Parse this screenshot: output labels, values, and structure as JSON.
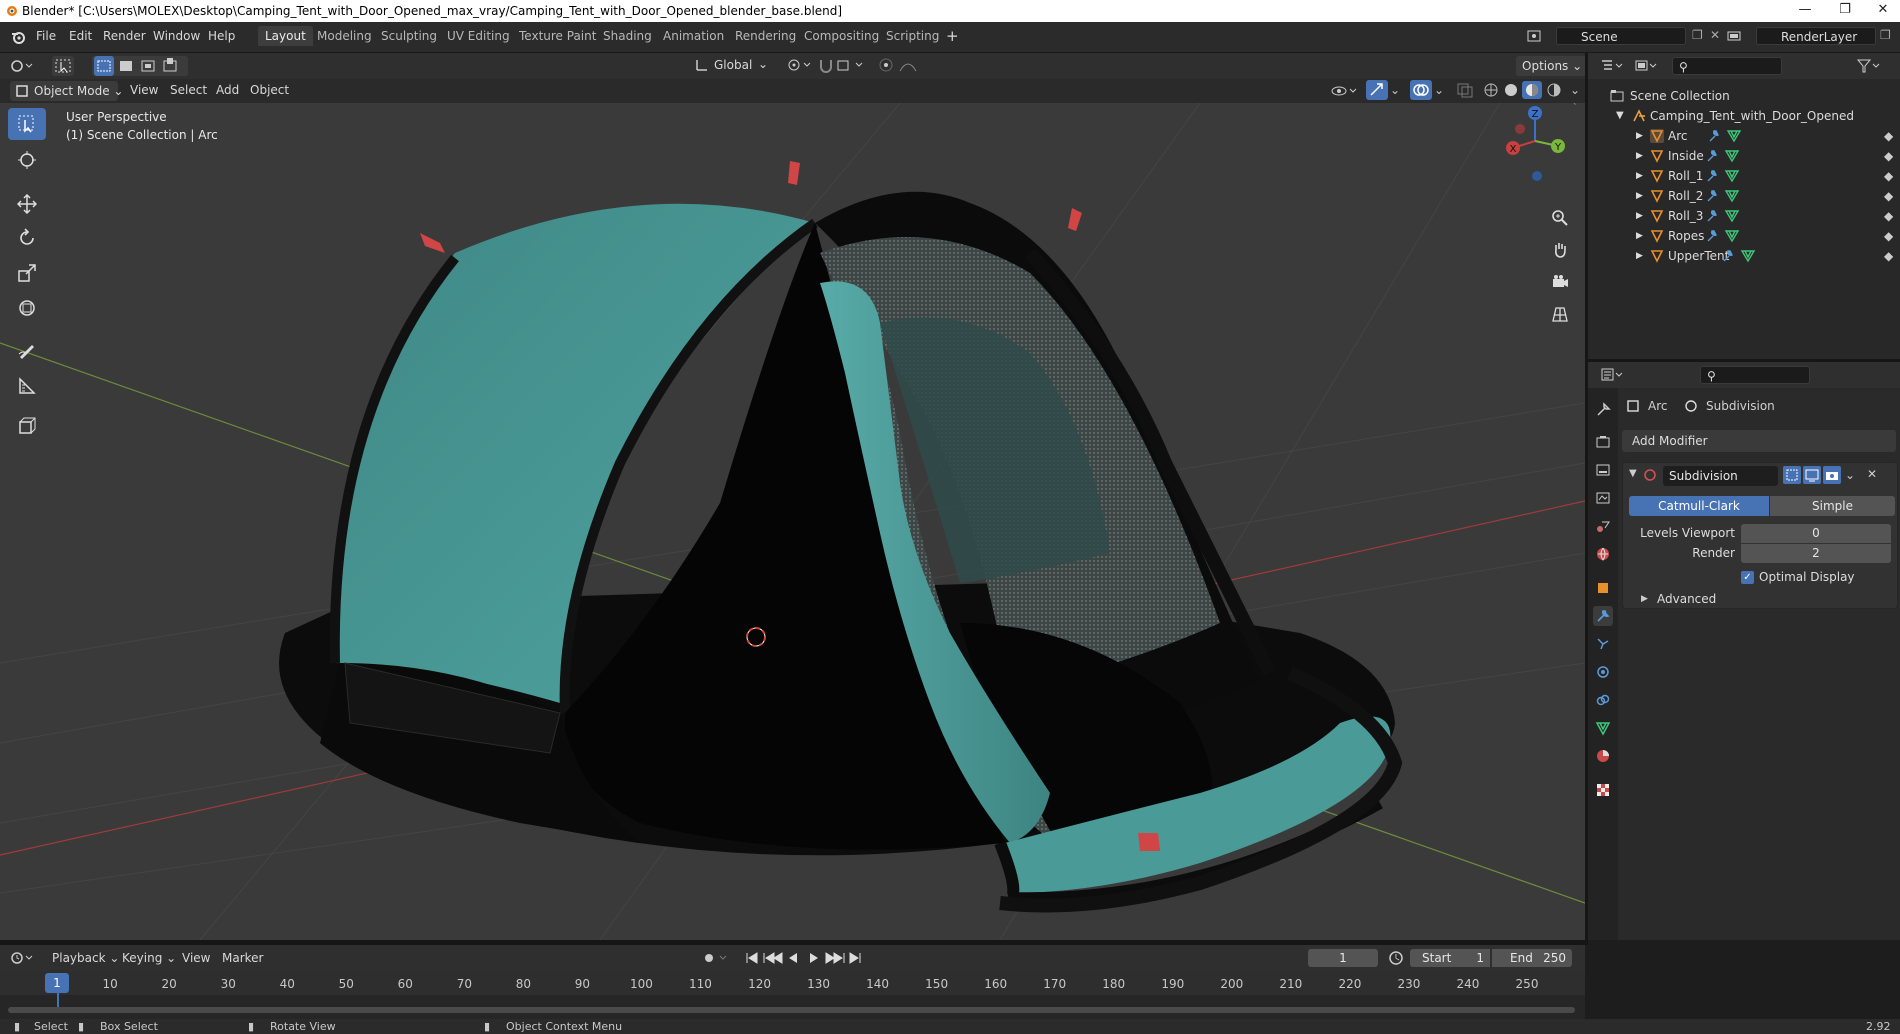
{
  "window": {
    "title": "Blender* [C:\\Users\\MOLEX\\Desktop\\Camping_Tent_with_Door_Opened_max_vray/Camping_Tent_with_Door_Opened_blender_base.blend]",
    "minimize_icon": "minimize-icon",
    "restore_icon": "restore-icon",
    "close_icon": "close-icon"
  },
  "menu": [
    "File",
    "Edit",
    "Render",
    "Window",
    "Help"
  ],
  "workspaces": [
    "Layout",
    "Modeling",
    "Sculpting",
    "UV Editing",
    "Texture Paint",
    "Shading",
    "Animation",
    "Rendering",
    "Compositing",
    "Scripting"
  ],
  "active_workspace": "Layout",
  "scene": {
    "name": "Scene",
    "view_layer": "RenderLayer"
  },
  "viewport_header": {
    "transform_orientation": "Global",
    "options": "Options",
    "mode": "Object Mode",
    "menus": [
      "View",
      "Select",
      "Add",
      "Object"
    ]
  },
  "viewport": {
    "perspective": "User Perspective",
    "collection_info": "(1) Scene Collection | Arc",
    "gizmo_axes": [
      "X",
      "Y",
      "Z"
    ]
  },
  "outliner": {
    "root": "Scene Collection",
    "collection": "Camping_Tent_with_Door_Opened",
    "objects": [
      "Arc",
      "Inside",
      "Roll_1",
      "Roll_2",
      "Roll_3",
      "Ropes",
      "UpperTent"
    ]
  },
  "properties": {
    "object_name": "Arc",
    "modifier_name": "Subdivision",
    "add_modifier": "Add Modifier",
    "modifier_panel_name": "Subdivision",
    "algorithm_options": [
      "Catmull-Clark",
      "Simple"
    ],
    "active_algorithm": "Catmull-Clark",
    "levels_viewport_label": "Levels Viewport",
    "levels_viewport": "0",
    "render_label": "Render",
    "render_levels": "2",
    "optimal_display_label": "Optimal Display",
    "optimal_display": true,
    "advanced_label": "Advanced"
  },
  "timeline": {
    "menus": [
      "Playback",
      "Keying",
      "View",
      "Marker"
    ],
    "current_frame": "1",
    "start_label": "Start",
    "start": "1",
    "end_label": "End",
    "end": "250",
    "ticks": [
      "1",
      "10",
      "20",
      "30",
      "40",
      "50",
      "60",
      "70",
      "80",
      "90",
      "100",
      "110",
      "120",
      "130",
      "140",
      "150",
      "160",
      "170",
      "180",
      "190",
      "200",
      "210",
      "220",
      "230",
      "240",
      "250"
    ]
  },
  "statusbar": {
    "select": "Select",
    "box_select": "Box Select",
    "rotate_view": "Rotate View",
    "context_menu": "Object Context Menu",
    "version": "2.92"
  },
  "colors": {
    "accent": "#4772b3",
    "tent_teal": "#4a9a98",
    "header": "#2f2f2f",
    "viewport_bg": "#3a3a3a"
  }
}
